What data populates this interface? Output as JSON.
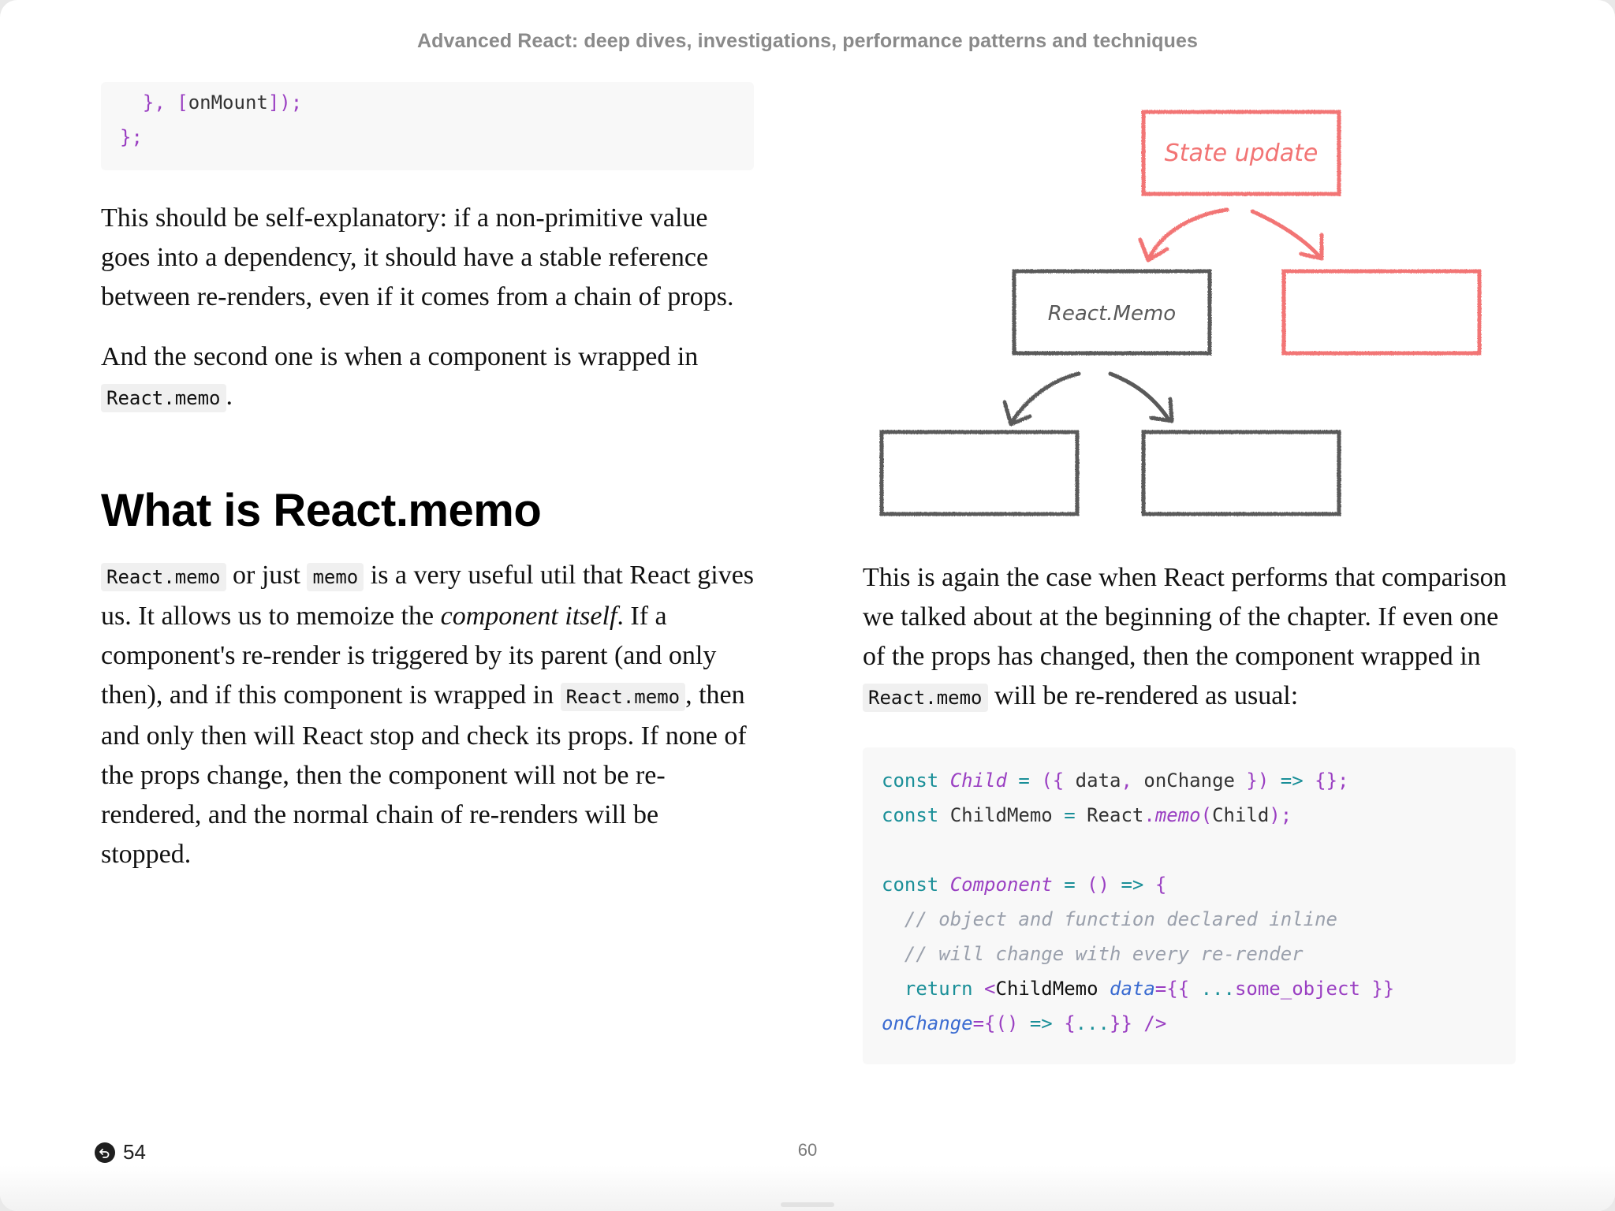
{
  "book": {
    "title": "Advanced React: deep dives, investigations, performance patterns and techniques"
  },
  "left_page": {
    "code_top": {
      "lines": [
        [
          {
            "t": "  ",
            "c": "id"
          },
          {
            "t": "}, [",
            "c": "punct"
          },
          {
            "t": "onMount",
            "c": "id"
          },
          {
            "t": "]);",
            "c": "punct"
          }
        ],
        [
          {
            "t": "};",
            "c": "punct"
          }
        ]
      ]
    },
    "para1": "This should be self-explanatory: if a non-primitive value goes into a dependency, it should have a stable reference between re-renders, even if it comes from a chain of props.",
    "para2_text": "And the second one is when a component is wrapped in",
    "para2_code": "React.memo",
    "para2_end": ".",
    "heading": "What is React.memo",
    "para3": {
      "code1": "React.memo",
      "t1": " or just ",
      "code2": "memo",
      "t2": " is a very useful util that React gives us. It allows us to memoize the ",
      "em": "component itself",
      "t3": ". If a component's re-render is triggered by its parent (and only then), and if this component is wrapped in ",
      "code3": "React.memo",
      "t4": ", then and only then will React stop and check its props. If none of the props change, then the component will not be re-rendered, and the normal chain of re-renders will be stopped."
    }
  },
  "diagram": {
    "state_update_label": "State update",
    "react_memo_label": "React.Memo",
    "colors": {
      "red": "#f27474",
      "gray": "#5a5a5a"
    }
  },
  "right_page": {
    "para1_text": "This is again the case when React performs that com­parison we talked about at the beginning of the chapter. If even one of the props has changed, then the compo­nent wrapped in ",
    "para1_code": "React.memo",
    "para1_end": " will be re-rendered as usual:",
    "code": {
      "lines": [
        [
          {
            "t": "const ",
            "c": "kw"
          },
          {
            "t": "Child",
            "c": "fn"
          },
          {
            "t": " = ",
            "c": "kw"
          },
          {
            "t": "({ ",
            "c": "punct"
          },
          {
            "t": "data",
            "c": "id"
          },
          {
            "t": ", ",
            "c": "punct"
          },
          {
            "t": "onChange ",
            "c": "id"
          },
          {
            "t": "}) ",
            "c": "punct"
          },
          {
            "t": "=> ",
            "c": "kw"
          },
          {
            "t": "{};",
            "c": "punct"
          }
        ],
        [
          {
            "t": "const ",
            "c": "kw"
          },
          {
            "t": "ChildMemo ",
            "c": "id"
          },
          {
            "t": "= ",
            "c": "kw"
          },
          {
            "t": "React",
            "c": "id"
          },
          {
            "t": ".",
            "c": "punct"
          },
          {
            "t": "memo",
            "c": "fn"
          },
          {
            "t": "(",
            "c": "punct"
          },
          {
            "t": "Child",
            "c": "id"
          },
          {
            "t": ");",
            "c": "punct"
          }
        ],
        [],
        [
          {
            "t": "const ",
            "c": "kw"
          },
          {
            "t": "Component",
            "c": "fn"
          },
          {
            "t": " = ",
            "c": "kw"
          },
          {
            "t": "() ",
            "c": "punct"
          },
          {
            "t": "=> ",
            "c": "kw"
          },
          {
            "t": "{",
            "c": "punct"
          }
        ],
        [
          {
            "t": "  // object and function declared inline",
            "c": "cmt"
          }
        ],
        [
          {
            "t": "  // will change with every re-render",
            "c": "cmt"
          }
        ],
        [
          {
            "t": "  return ",
            "c": "kw"
          },
          {
            "t": "<",
            "c": "punct"
          },
          {
            "t": "ChildMemo ",
            "c": "tag"
          },
          {
            "t": "data",
            "c": "attr"
          },
          {
            "t": "={{ ",
            "c": "punct"
          },
          {
            "t": "...",
            "c": "kw"
          },
          {
            "t": "some_object ",
            "c": "str"
          },
          {
            "t": "}}",
            "c": "punct"
          }
        ],
        [
          {
            "t": "onChange",
            "c": "attr"
          },
          {
            "t": "={() ",
            "c": "punct"
          },
          {
            "t": "=> ",
            "c": "kw"
          },
          {
            "t": "{",
            "c": "punct"
          },
          {
            "t": "...",
            "c": "kw"
          },
          {
            "t": "}} />",
            "c": "punct"
          }
        ]
      ]
    }
  },
  "footer": {
    "back_label": "54",
    "page_number": "60"
  }
}
